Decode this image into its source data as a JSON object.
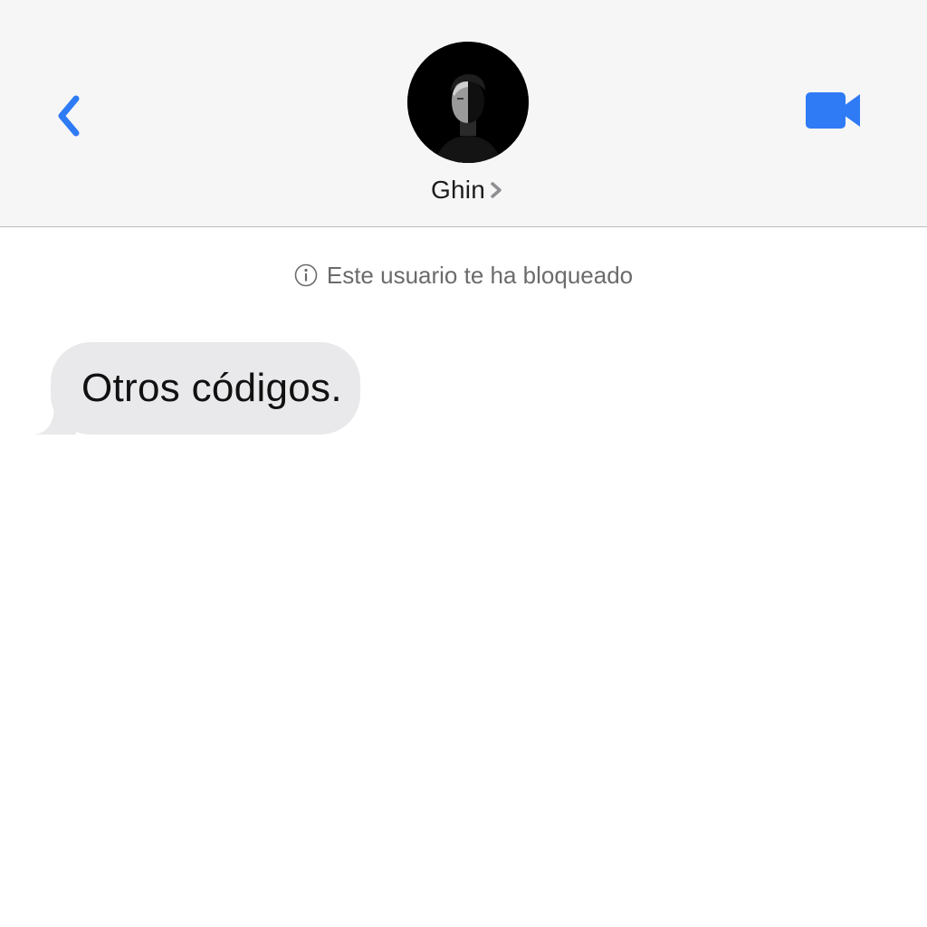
{
  "header": {
    "contact_name": "Ghin",
    "back_icon": "chevron-left-icon",
    "video_icon": "video-camera-icon",
    "chevron_icon": "chevron-right-icon",
    "avatar_icon": "avatar-photo"
  },
  "notice": {
    "icon": "info-icon",
    "text": "Este usuario te ha bloqueado"
  },
  "messages": [
    {
      "direction": "incoming",
      "text": "Otros códigos."
    }
  ],
  "colors": {
    "accent": "#2f7bf5",
    "header_bg": "#f6f6f6",
    "bubble_incoming": "#e9e9eb",
    "notice_text": "#6b6b6b"
  }
}
